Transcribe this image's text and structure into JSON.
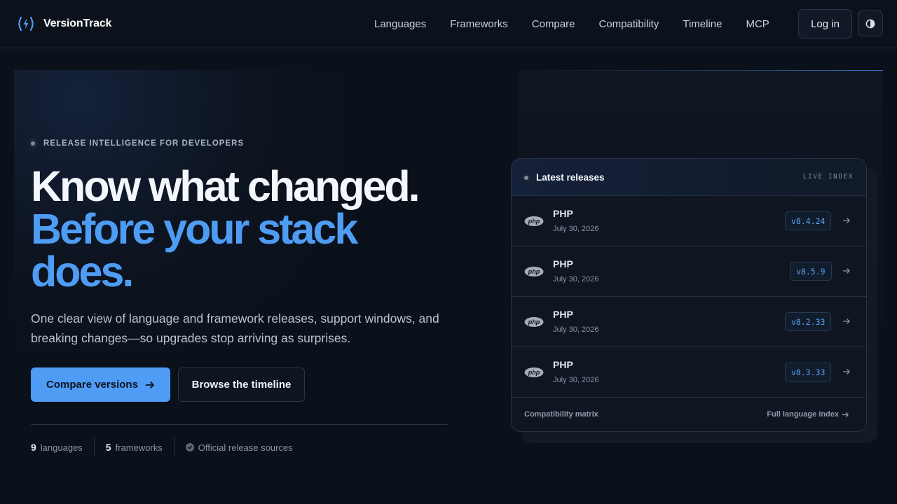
{
  "app": {
    "name": "VersionTrack"
  },
  "nav": {
    "items": [
      "Languages",
      "Frameworks",
      "Compare",
      "Compatibility",
      "Timeline",
      "MCP"
    ],
    "login_label": "Log in"
  },
  "hero": {
    "eyebrow": "RELEASE INTELLIGENCE FOR DEVELOPERS",
    "title_line1": "Know what changed.",
    "title_line2": "Before your stack",
    "title_line3": "does.",
    "lead": "One clear view of language and framework releases, support windows, and breaking changes—so upgrades stop arriving as surprises.",
    "cta_primary": "Compare versions",
    "cta_secondary": "Browse the timeline",
    "stats": [
      {
        "num": "9",
        "label": "languages"
      },
      {
        "num": "5",
        "label": "frameworks"
      }
    ],
    "sources_label": "Official release sources"
  },
  "releases": {
    "title": "Latest releases",
    "badge": "LIVE INDEX",
    "items": [
      {
        "name": "PHP",
        "date": "July 30, 2026",
        "version": "v8.4.24"
      },
      {
        "name": "PHP",
        "date": "July 30, 2026",
        "version": "v8.5.9"
      },
      {
        "name": "PHP",
        "date": "July 30, 2026",
        "version": "v8.2.33"
      },
      {
        "name": "PHP",
        "date": "July 30, 2026",
        "version": "v8.3.33"
      }
    ],
    "footer_left": "Compatibility matrix",
    "footer_right": "Full language index"
  },
  "colors": {
    "accent": "#4f9cf5",
    "background": "#0b111b",
    "version_text": "#5da2f3"
  },
  "icons": {
    "logo": "lightning-brackets-icon",
    "theme": "half-circle-contrast-icon",
    "cta_arrow": "arrow-right-icon",
    "sources": "check-circle-icon",
    "row_arrow": "arrow-right-icon",
    "language_logo": "php-logo-icon"
  }
}
